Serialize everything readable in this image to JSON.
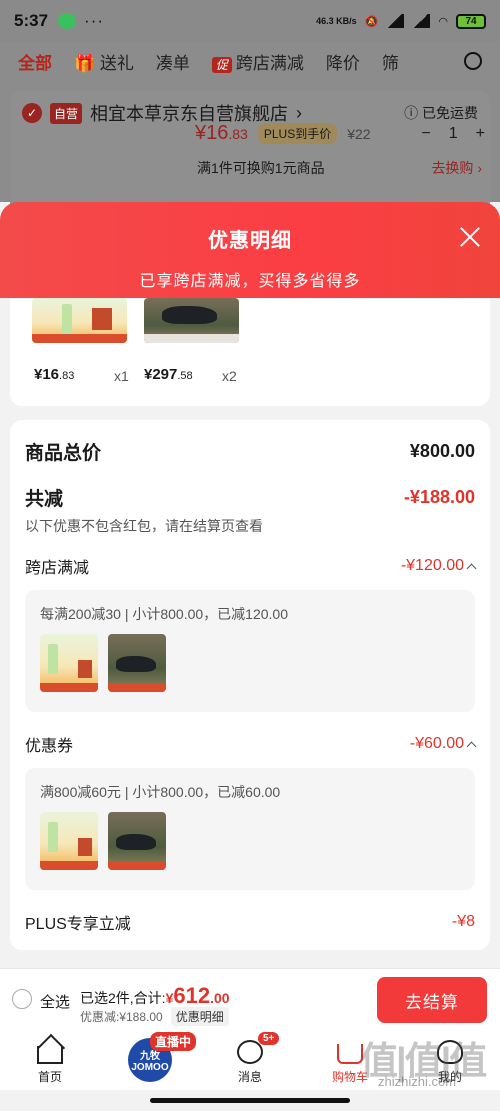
{
  "status": {
    "time": "5:37",
    "net_speed": "46.3 KB/s",
    "battery": "74"
  },
  "tabs": {
    "all": "全部",
    "gift": "送礼",
    "combine": "凑单",
    "cu_tag": "促",
    "cross_store": "跨店满减",
    "price_drop": "降价",
    "filter": "筛"
  },
  "store": {
    "self_tag": "自营",
    "name": "相宜本草京东自营旗舰店",
    "chevron": "›",
    "free_shipping": "已免运费",
    "price_symbol": "¥",
    "price_int": "16",
    "price_dec": ".83",
    "plus_tag": "PLUS到手价",
    "orig_price": "¥22",
    "minus": "−",
    "qty": "1",
    "plus": "+",
    "exchange": "满1件可换购1元商品",
    "go_exchange": "去换购 ›"
  },
  "modal": {
    "title": "优惠明细",
    "subtitle": "已享跨店满减，买得多省得多"
  },
  "goods": [
    {
      "price_int": "¥16",
      "price_dec": ".83",
      "qty": "x1"
    },
    {
      "price_int": "¥297",
      "price_dec": ".58",
      "qty": "x2"
    }
  ],
  "detail": {
    "total_label": "商品总价",
    "total_value": "¥800.00",
    "reduce_label": "共减",
    "reduce_value": "-¥188.00",
    "reduce_note": "以下优惠不包含红包，请在结算页查看",
    "cross_label": "跨店满减",
    "cross_value": "-¥120.00",
    "cross_desc": "每满200减30 | 小计800.00，已减120.00",
    "coupon_label": "优惠券",
    "coupon_value": "-¥60.00",
    "coupon_desc": "满800减60元 | 小计800.00，已减60.00",
    "plus_label": "PLUS专享立减",
    "plus_value": "-¥8"
  },
  "checkout": {
    "select_all": "全选",
    "selected": "已选2件,合计:",
    "total_symbol": "¥",
    "total_int": "612",
    "total_dec": ".00",
    "discount": "优惠减:¥188.00",
    "detail_btn": "优惠明细",
    "btn": "去结算"
  },
  "nav": {
    "home": "首页",
    "live_badge": "直播中",
    "live_brand": "九牧 JOMOO",
    "msg": "消息",
    "msg_badge": "5+",
    "cart": "购物车",
    "me": "我的"
  },
  "watermark": {
    "text": "值|值|值",
    "url": "zhizhizhi.com"
  }
}
